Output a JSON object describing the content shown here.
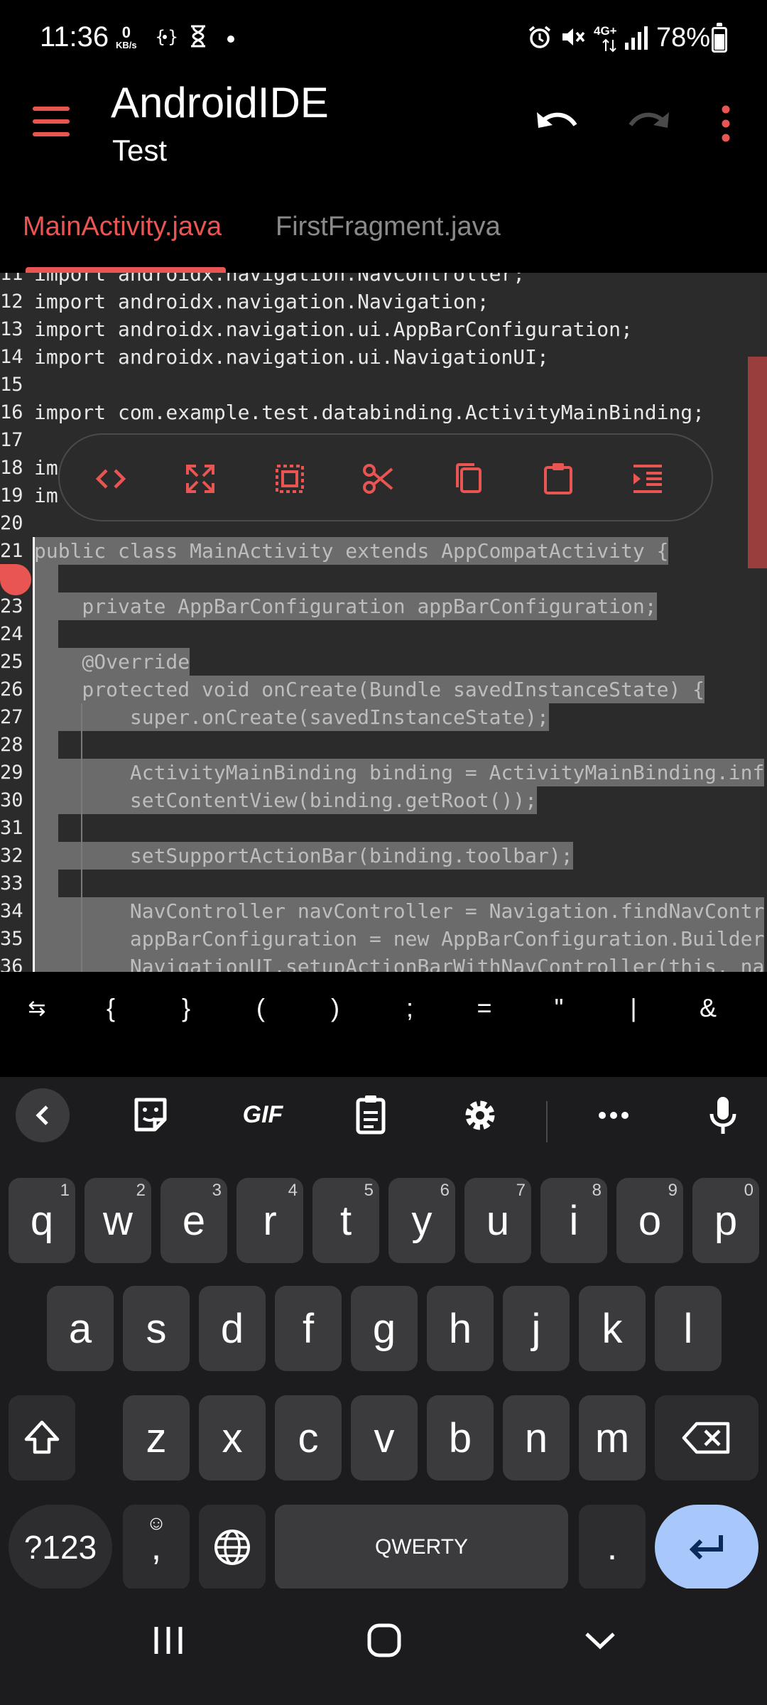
{
  "status_bar": {
    "time": "11:36",
    "net_speed_value": "0",
    "net_speed_unit": "KB/s",
    "network": "4G+",
    "battery": "78%",
    "icons": [
      "code-bracket-icon",
      "hourglass-icon",
      "dot-icon",
      "alarm-icon",
      "mute-icon",
      "data-arrows-icon",
      "signal-icon",
      "battery-icon"
    ]
  },
  "app_bar": {
    "title": "AndroidIDE",
    "subtitle": "Test",
    "accent": "#e85552"
  },
  "tabs": [
    {
      "label": "MainActivity.java",
      "active": true
    },
    {
      "label": "FirstFragment.java",
      "active": false
    }
  ],
  "editor": {
    "lines": [
      {
        "n": "11",
        "text": "import androidx.navigation.NavController;"
      },
      {
        "n": "12",
        "text": "import androidx.navigation.Navigation;"
      },
      {
        "n": "13",
        "text": "import androidx.navigation.ui.AppBarConfiguration;"
      },
      {
        "n": "14",
        "text": "import androidx.navigation.ui.NavigationUI;"
      },
      {
        "n": "15",
        "text": ""
      },
      {
        "n": "16",
        "text": "import com.example.test.databinding.ActivityMainBinding;"
      },
      {
        "n": "17",
        "text": ""
      },
      {
        "n": "18",
        "text": "im"
      },
      {
        "n": "19",
        "text": "im"
      },
      {
        "n": "20",
        "text": ""
      },
      {
        "n": "21",
        "text": "public class MainActivity extends AppCompatActivity {"
      },
      {
        "n": "22",
        "text": ""
      },
      {
        "n": "23",
        "text": "    private AppBarConfiguration appBarConfiguration;"
      },
      {
        "n": "24",
        "text": ""
      },
      {
        "n": "25",
        "text": "    @Override"
      },
      {
        "n": "26",
        "text": "    protected void onCreate(Bundle savedInstanceState) {"
      },
      {
        "n": "27",
        "text": "        super.onCreate(savedInstanceState);"
      },
      {
        "n": "28",
        "text": ""
      },
      {
        "n": "29",
        "text": "        ActivityMainBinding binding = ActivityMainBinding.inf"
      },
      {
        "n": "30",
        "text": "        setContentView(binding.getRoot());"
      },
      {
        "n": "31",
        "text": ""
      },
      {
        "n": "32",
        "text": "        setSupportActionBar(binding.toolbar);"
      },
      {
        "n": "33",
        "text": ""
      },
      {
        "n": "34",
        "text": "        NavController navController = Navigation.findNavContr"
      },
      {
        "n": "35",
        "text": "        appBarConfiguration = new AppBarConfiguration.Builder"
      },
      {
        "n": "36",
        "text": "        NavigationUI.setupActionBarWithNavController(this, na"
      }
    ]
  },
  "text_actions": [
    "code-icon",
    "expand-icon",
    "select-all-icon",
    "cut-icon",
    "copy-icon",
    "paste-icon",
    "indent-icon"
  ],
  "symbols": [
    "⇆",
    "{",
    "}",
    "(",
    ")",
    ";",
    "=",
    "\"",
    "|",
    "&"
  ],
  "keyboard": {
    "toolbar": [
      "back-chevron-icon",
      "sticker-icon",
      "GIF",
      "clipboard-icon",
      "settings-icon",
      "more-icon",
      "mic-icon"
    ],
    "row1": [
      {
        "k": "q",
        "h": "1"
      },
      {
        "k": "w",
        "h": "2"
      },
      {
        "k": "e",
        "h": "3"
      },
      {
        "k": "r",
        "h": "4"
      },
      {
        "k": "t",
        "h": "5"
      },
      {
        "k": "y",
        "h": "6"
      },
      {
        "k": "u",
        "h": "7"
      },
      {
        "k": "i",
        "h": "8"
      },
      {
        "k": "o",
        "h": "9"
      },
      {
        "k": "p",
        "h": "0"
      }
    ],
    "row2": [
      "a",
      "s",
      "d",
      "f",
      "g",
      "h",
      "j",
      "k",
      "l"
    ],
    "row3": [
      "z",
      "x",
      "c",
      "v",
      "b",
      "n",
      "m"
    ],
    "symbols_key": "?123",
    "comma": ",",
    "space": "QWERTY",
    "period": ".",
    "enter_color": "#a8c7fa"
  }
}
